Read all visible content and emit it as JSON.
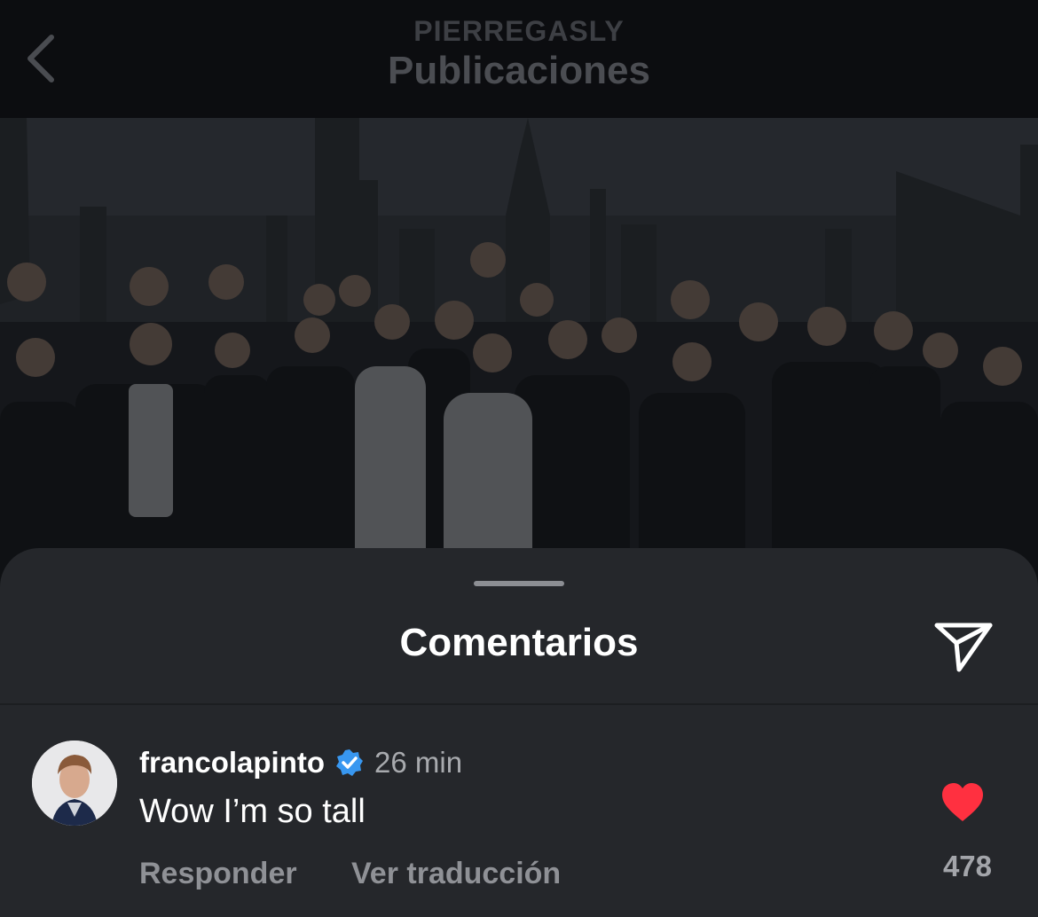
{
  "header": {
    "username": "PIERREGASLY",
    "title": "Publicaciones",
    "back_icon": "chevron-left-icon"
  },
  "post": {
    "image_description_hidden": false
  },
  "comments_sheet": {
    "title": "Comentarios",
    "share_icon": "paper-plane-icon"
  },
  "comment": {
    "username": "francolapinto",
    "verified": true,
    "time": "26 min",
    "text": "Wow I’m so tall",
    "reply_label": "Responder",
    "translate_label": "Ver traducción",
    "likes": "478",
    "liked": true
  },
  "colors": {
    "like_red": "#ff3040",
    "verified_blue": "#3897f0",
    "sheet_bg": "#25272b",
    "header_bg": "#0c0d10"
  }
}
